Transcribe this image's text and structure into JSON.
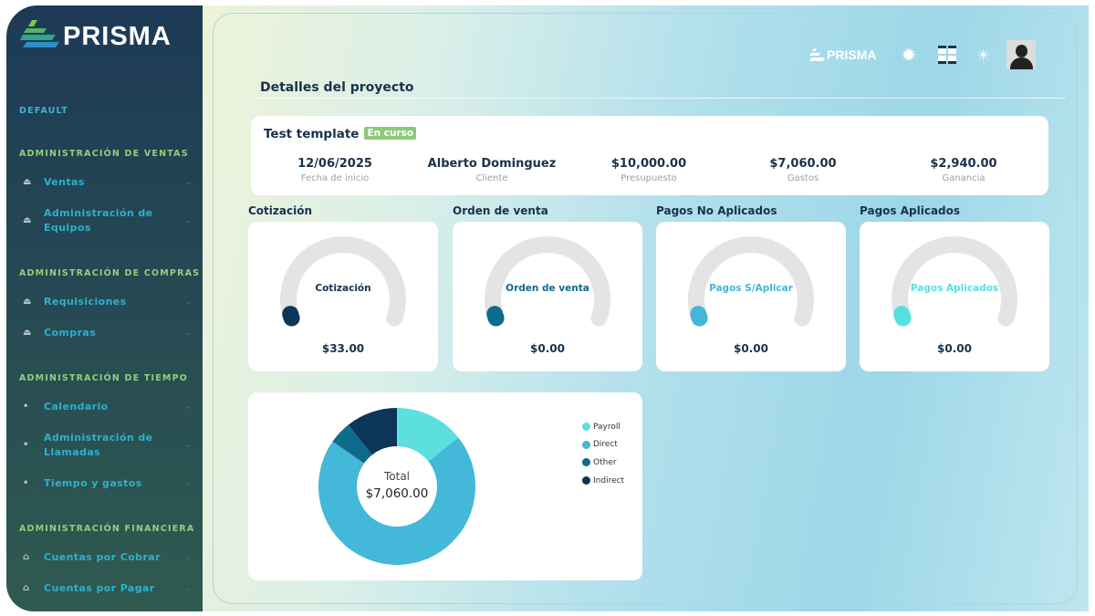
{
  "sidebar": {
    "brand": "PRISMA",
    "sections": [
      {
        "title": "DEFAULT",
        "items": []
      },
      {
        "title": "ADMINISTRACIÓN DE VENTAS",
        "items": [
          {
            "label": "Ventas",
            "icon": "basket-icon"
          },
          {
            "label": "Administración de Equipos",
            "icon": "basket-icon"
          }
        ]
      },
      {
        "title": "ADMINISTRACIÓN DE COMPRAS",
        "items": [
          {
            "label": "Requisiciones",
            "icon": "basket-icon"
          },
          {
            "label": "Compras",
            "icon": "basket-icon"
          }
        ]
      },
      {
        "title": "ADMINISTRACIÓN DE TIEMPO",
        "items": [
          {
            "label": "Calendario",
            "icon": "dot-icon"
          },
          {
            "label": "Administración de Llamadas",
            "icon": "dot-icon"
          },
          {
            "label": "Tiempo y gastos",
            "icon": "dot-icon"
          }
        ]
      },
      {
        "title": "ADMINISTRACIÓN FINANCIERA",
        "items": [
          {
            "label": "Cuentas por Cobrar",
            "icon": "bank-icon"
          },
          {
            "label": "Cuentas por Pagar",
            "icon": "bank-icon"
          }
        ]
      }
    ]
  },
  "header": {
    "brand": "PRISMA",
    "icons": [
      "settings-icon",
      "apps-grid-icon",
      "theme-sun-icon",
      "user-avatar"
    ]
  },
  "page_title": "Detalles del proyecto",
  "project": {
    "name": "Test template",
    "status": "En curso",
    "status_color": "#8cc97a",
    "stats": [
      {
        "value": "12/06/2025",
        "label": "Fecha de inicio"
      },
      {
        "value": "Alberto Dominguez",
        "label": "Cliente"
      },
      {
        "value": "$10,000.00",
        "label": "Presupuesto"
      },
      {
        "value": "$7,060.00",
        "label": "Gastos"
      },
      {
        "value": "$2,940.00",
        "label": "Ganancia"
      }
    ]
  },
  "gauges": [
    {
      "title": "Cotización",
      "label": "Cotización",
      "value": "$33.00",
      "fraction": 0.0033,
      "color": "#0d3558"
    },
    {
      "title": "Orden de venta",
      "label": "Orden de venta",
      "value": "$0.00",
      "fraction": 0,
      "color": "#0f6b8c"
    },
    {
      "title": "Pagos No Aplicados",
      "label": "Pagos S/Aplicar",
      "value": "$0.00",
      "fraction": 0,
      "color": "#45b6d6"
    },
    {
      "title": "Pagos Aplicados",
      "label": "Pagos Aplicados",
      "value": "$0.00",
      "fraction": 0,
      "color": "#58dfe0"
    }
  ],
  "chart_data": {
    "type": "pie",
    "variant": "donut",
    "center_label": "Total",
    "center_value": "$7,060.00",
    "legend_position": "right",
    "categories": [
      "Payroll",
      "Direct",
      "Other",
      "Indirect"
    ],
    "values": [
      1010,
      4970,
      330,
      750
    ],
    "colors": [
      "#5ddfe0",
      "#43b8d8",
      "#0f6b8c",
      "#0d3558"
    ]
  }
}
